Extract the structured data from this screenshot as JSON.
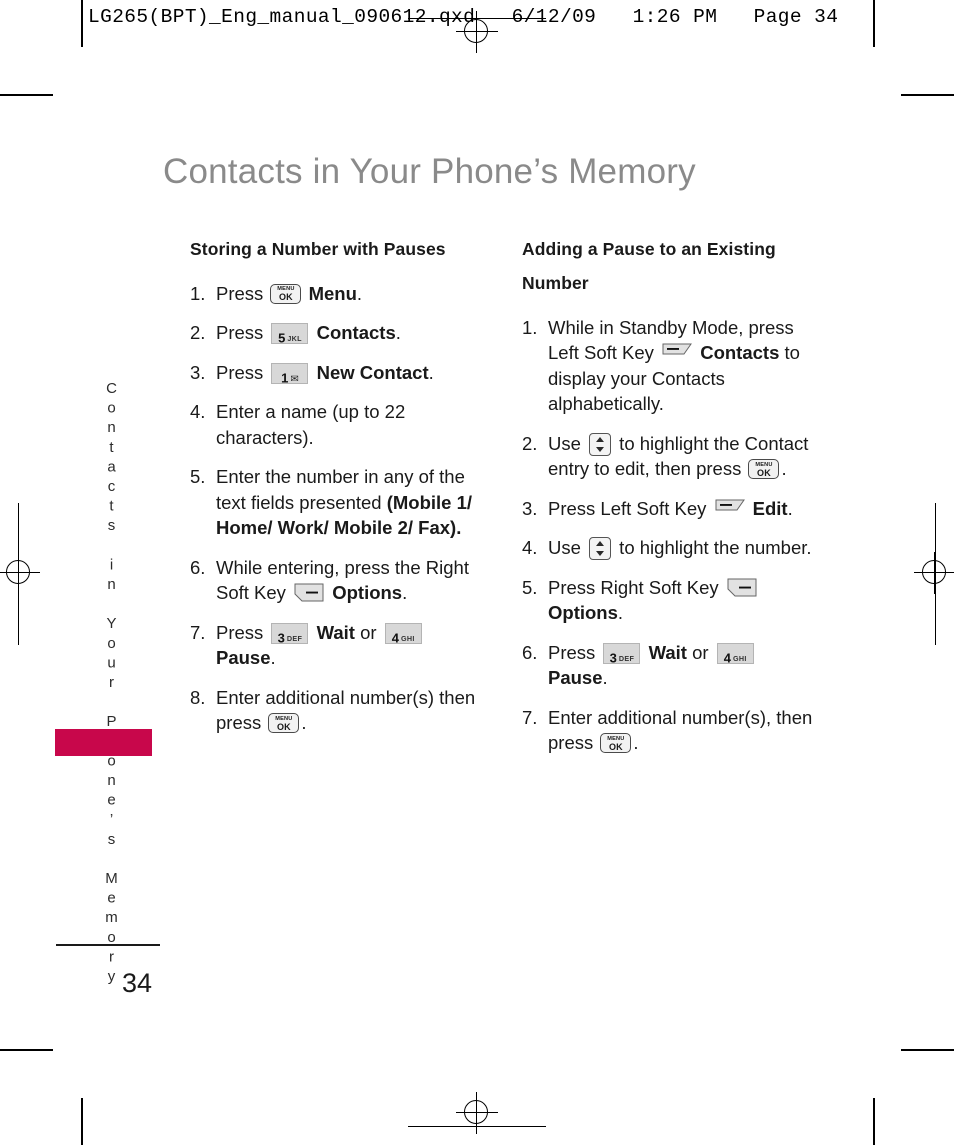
{
  "print_header": "LG265(BPT)_Eng_manual_090612.qxd   6/12/09   1:26 PM   Page 34",
  "page_title": "Contacts in Your Phone’s Memory",
  "side_tab": {
    "label": "Contacts in Your Phone’s Memory",
    "color": "#C8074B"
  },
  "footer": {
    "page_number": "34"
  },
  "keys": {
    "menuok_line1": "MENU",
    "menuok_line2": "OK",
    "k5_digit": "5",
    "k5_letters": "JKL",
    "k1_digit": "1",
    "k1_symbol": "✉",
    "k3_digit": "3",
    "k3_letters": "DEF",
    "k4_digit": "4",
    "k4_letters": "GHI"
  },
  "left_column": {
    "heading": "Storing a Number with Pauses",
    "steps": [
      {
        "num": "1.",
        "pre": "Press ",
        "post": " Menu.",
        "post_bold": "Menu",
        "post_tail": "."
      },
      {
        "num": "2.",
        "pre": "Press ",
        "post_bold": "Contacts",
        "post_tail": "."
      },
      {
        "num": "3.",
        "pre": "Press ",
        "post_bold": "New Contact",
        "post_tail": "."
      },
      {
        "num": "4.",
        "text": "Enter a name (up to 22 characters)."
      },
      {
        "num": "5.",
        "pre": "Enter the number in any of the text fields presented ",
        "post_bold": "(Mobile 1/ Home/ Work/ Mobile 2/ Fax)."
      },
      {
        "num": "6.",
        "pre": "While entering, press the Right Soft Key ",
        "post_bold": "Options",
        "post_tail": "."
      },
      {
        "num": "7.",
        "pre": "Press ",
        "mid_bold": "Wait",
        "mid": " or ",
        "post_bold": "Pause",
        "post_tail": "."
      },
      {
        "num": "8.",
        "pre": "Enter additional number(s) then press ",
        "post_tail": "."
      }
    ]
  },
  "right_column": {
    "heading": "Adding a Pause to an Existing Number",
    "steps": [
      {
        "num": "1.",
        "pre": "While in Standby Mode, press Left Soft Key ",
        "post_bold": "Contacts",
        "post_tail": " to display your Contacts alphabetically."
      },
      {
        "num": "2.",
        "pre": "Use ",
        "mid": " to highlight the Contact entry to edit, then press ",
        "post_tail": "."
      },
      {
        "num": "3.",
        "pre": "Press Left Soft Key ",
        "post_bold": "Edit",
        "post_tail": "."
      },
      {
        "num": "4.",
        "pre": "Use ",
        "mid": " to highlight the number."
      },
      {
        "num": "5.",
        "pre": "Press Right Soft Key ",
        "post_bold": "Options",
        "post_tail": "."
      },
      {
        "num": "6.",
        "pre": "Press ",
        "mid_bold": "Wait",
        "mid": " or ",
        "post_bold": "Pause",
        "post_tail": "."
      },
      {
        "num": "7.",
        "pre": "Enter additional number(s), then press ",
        "post_tail": "."
      }
    ]
  }
}
